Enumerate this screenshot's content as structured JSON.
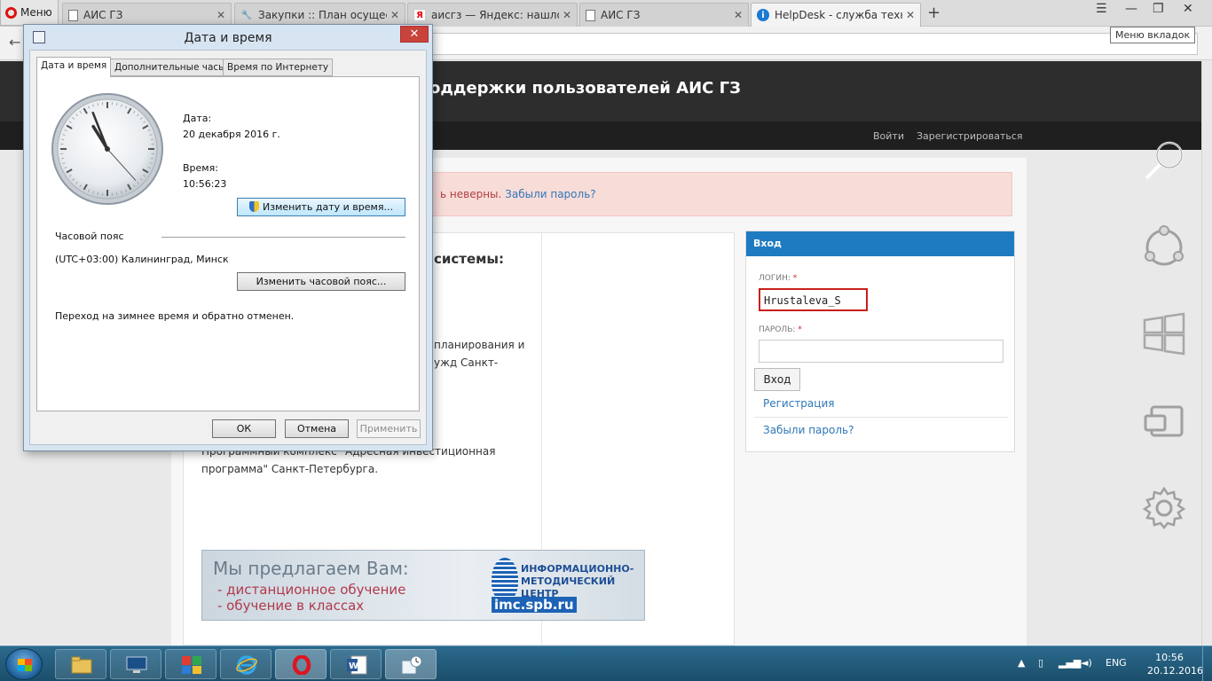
{
  "browser": {
    "menu_label": "Меню",
    "tabs": [
      {
        "title": "АИС ГЗ",
        "favicon": "page-icon"
      },
      {
        "title": "Закупки :: План осуществ",
        "favicon": "tools-icon"
      },
      {
        "title": "аисгз — Яндекс: нашлось",
        "favicon": "yandex-icon"
      },
      {
        "title": "АИС ГЗ",
        "favicon": "page-icon"
      },
      {
        "title": "HelpDesk - служба техни",
        "favicon": "helpdesk-icon"
      }
    ],
    "tab_menu_tooltip": "Меню вкладок"
  },
  "site": {
    "title": "оддержки пользователей АИС ГЗ",
    "nav": {
      "login": "Войти",
      "register": "Зарегистрироваться"
    },
    "alert": {
      "text": "ь неверны.",
      "link": "Забыли пароль?"
    },
    "main": {
      "heading": "системы:",
      "para1": [
        "планирования и",
        "ужд Санкт-"
      ],
      "para2": [
        "Программный комплекс \"Адресная инвестиционная",
        "программа\" Санкт-Петербурга."
      ]
    },
    "banner": {
      "title": "Мы предлагаем Вам:",
      "lines": [
        "- дистанционное обучение",
        "- обучение в классах"
      ],
      "logo_text": [
        "ИНФОРМАЦИОННО-",
        "МЕТОДИЧЕСКИЙ ЦЕНТР"
      ],
      "logo_url": "imc.spb.ru"
    },
    "login": {
      "header": "Вход",
      "login_label": "ЛОГИН:",
      "login_value": "Hrustaleva_S",
      "password_label": "ПАРОЛЬ:",
      "required_mark": "*",
      "submit": "Вход",
      "register_link": "Регистрация",
      "forgot_link": "Забыли пароль?"
    }
  },
  "dialog": {
    "title": "Дата и время",
    "tabs": [
      "Дата и время",
      "Дополнительные часы",
      "Время по Интернету"
    ],
    "date_label": "Дата:",
    "date_value": "20 декабря 2016 г.",
    "time_label": "Время:",
    "time_value": "10:56:23",
    "change_datetime_btn": "Изменить дату и время...",
    "timezone_label": "Часовой пояс",
    "timezone_value": "(UTC+03:00) Калининград, Минск",
    "change_tz_btn": "Изменить часовой пояс...",
    "dst_note": "Переход на зимнее время и обратно отменен.",
    "ok": "ОК",
    "cancel": "Отмена",
    "apply": "Применить",
    "clock": {
      "hours": 10,
      "minutes": 56,
      "seconds": 23
    }
  },
  "taskbar": {
    "apps": [
      "explorer-icon",
      "lenovo-icon",
      "control-panel-icon",
      "internet-explorer-icon",
      "opera-icon",
      "word-icon",
      "datetime-icon"
    ],
    "lang": "ENG",
    "time": "10:56",
    "date": "20.12.2016"
  },
  "colors": {
    "accent_blue": "#1f7bc1",
    "error_red": "#c9201a",
    "alert_bg": "#f8dcd8"
  }
}
